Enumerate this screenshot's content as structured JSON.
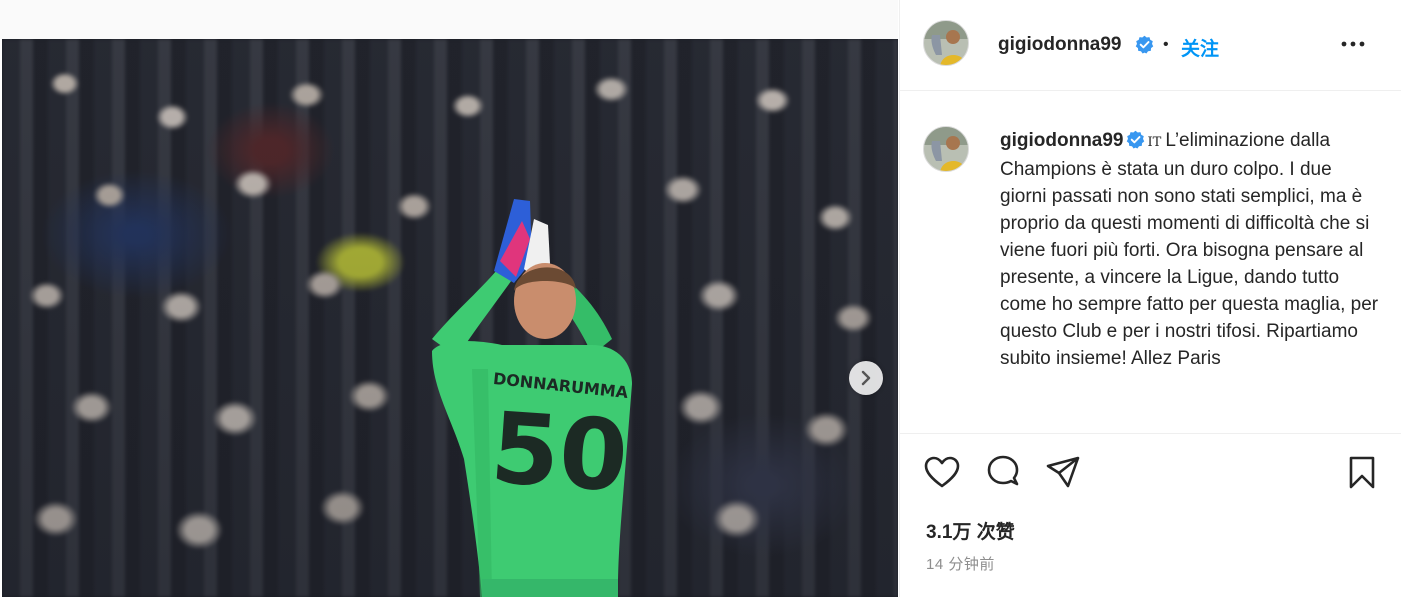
{
  "post": {
    "image_jersey_name": "DONNARUMMA",
    "image_jersey_number": "50"
  },
  "header": {
    "username": "gigiodonna99",
    "separator": "•",
    "follow_label": "关注"
  },
  "caption": {
    "username": "gigiodonna99",
    "language_tag": "IT",
    "text": "L’eliminazione dalla Champions è stata un duro colpo. I due giorni passati non sono stati semplici, ma è proprio da questi momenti di difficoltà che si viene fuori più forti. Ora bisogna pensare al presente, a vincere la Ligue, dando tutto come ho sempre fatto per questa maglia, per questo Club e per i nostri tifosi. Ripartiamo subito insieme! Allez Paris"
  },
  "engagement": {
    "likes_label": "3.1万 次赞",
    "time_label": "14 分钟前"
  },
  "icons": {
    "like": "heart-icon",
    "comment": "comment-icon",
    "share": "share-icon",
    "save": "bookmark-icon",
    "more": "more-icon",
    "next": "chevron-right-icon",
    "verified": "verified-badge-icon"
  },
  "colors": {
    "accent": "#0095f6",
    "verified": "#3897f0",
    "jersey": "#3ecb72",
    "text": "#262626",
    "muted": "#8e8e8e"
  }
}
